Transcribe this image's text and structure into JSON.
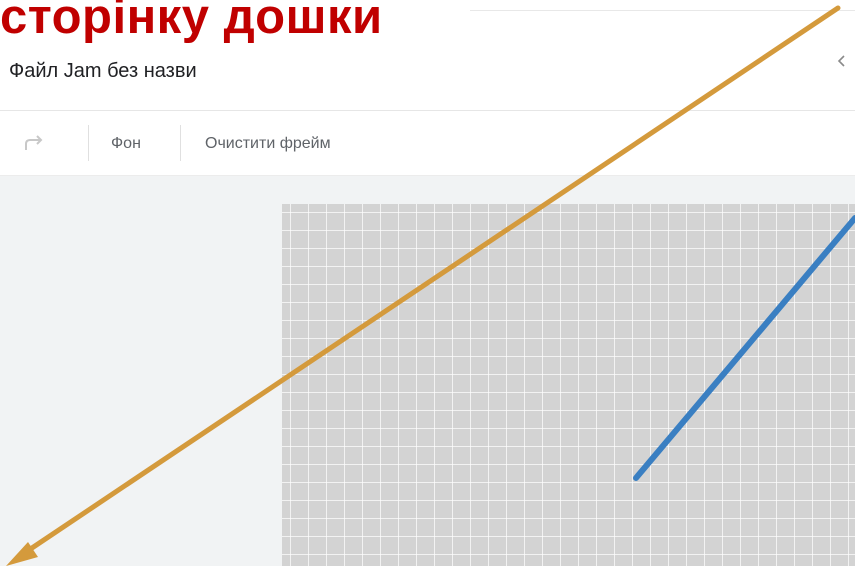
{
  "overlay": {
    "heading": "сторінку дошки",
    "arrow_color_orange": "#d49a3c",
    "arrow_color_blue": "#3a7fc2",
    "heading_color": "#c00000"
  },
  "header": {
    "file_title": "Файл Jam без назви",
    "collapse_icon": "chevron-left-icon"
  },
  "toolbar": {
    "redo_icon": "redo-icon",
    "background_label": "Фон",
    "clear_frame_label": "Очистити фрейм"
  },
  "canvas": {
    "background": "#f1f3f4",
    "frame_color": "#d3d3d3"
  }
}
